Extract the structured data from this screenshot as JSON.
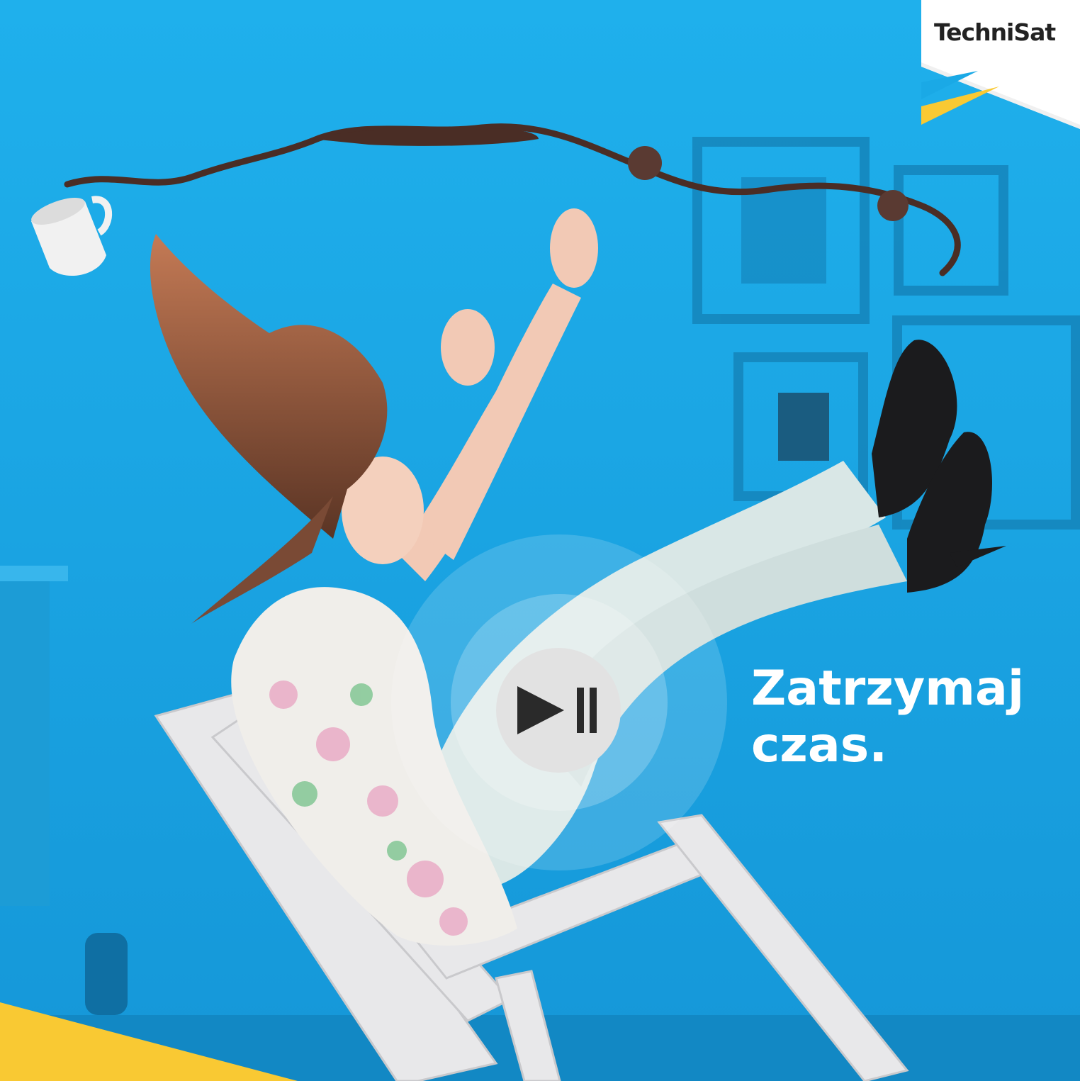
{
  "brand": {
    "name": "TechniSat",
    "colors": {
      "background": "#1aa9e6",
      "accent_yellow": "#f9c933",
      "text_white": "#ffffff",
      "logo_text": "#222222"
    }
  },
  "headline": {
    "line1": "Zatrzymaj",
    "line2": "czas."
  },
  "controls": {
    "play_pause_icon": "play-pause-icon"
  }
}
